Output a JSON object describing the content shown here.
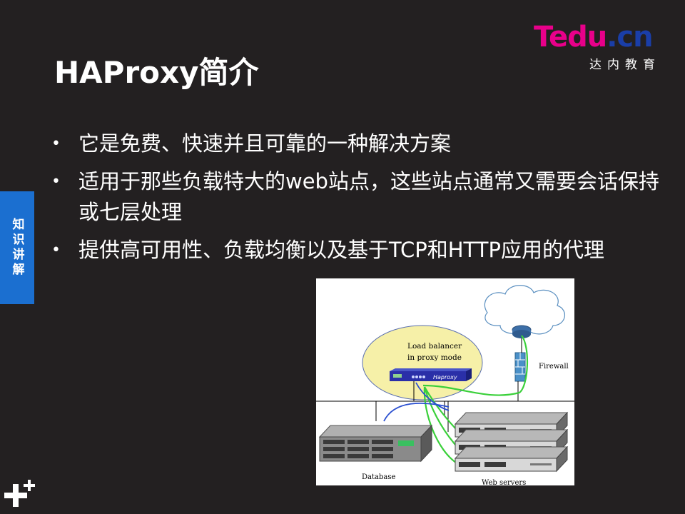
{
  "slide": {
    "title": "HAProxy简介",
    "side_tab": "知识讲解",
    "logo": {
      "brand_t": "T",
      "brand_edu": "edu",
      "brand_dot_cn": ".cn",
      "subtitle": "达内教育"
    },
    "bullets": [
      "它是免费、快速并且可靠的一种解决方案",
      "适用于那些负载特大的web站点，这些站点通常又需要会话保持或七层处理",
      "提供高可用性、负载均衡以及基于TCP和HTTP应用的代理"
    ],
    "figure": {
      "lb_label_line1": "Load balancer",
      "lb_label_line2": "in proxy mode",
      "device_label": "Haproxy",
      "firewall_label": "Firewall",
      "database_label": "Database",
      "webservers_label": "Web servers"
    },
    "colors": {
      "background": "#232021",
      "side_tab": "#1b6fd0",
      "logo_pink": "#e8008a",
      "logo_blue": "#1a3ea8"
    }
  }
}
